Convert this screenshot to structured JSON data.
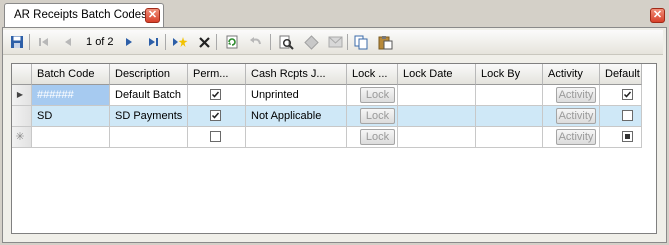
{
  "tab": {
    "title": "AR Receipts Batch Codes"
  },
  "toolbar": {
    "page_current": "1",
    "page_total": "of 2",
    "icons": [
      "save-icon",
      "first-record-icon",
      "previous-record-icon",
      "next-record-icon",
      "last-record-icon",
      "new-record-icon",
      "delete-icon",
      "refresh-icon",
      "undo-icon",
      "preview-icon",
      "diamond-icon",
      "mail-icon",
      "copy-icon",
      "paste-icon"
    ]
  },
  "grid": {
    "columns": [
      "Batch Code",
      "Description",
      "Perm...",
      "Cash Rcpts J...",
      "Lock ...",
      "Lock Date",
      "Lock By",
      "Activity",
      "Default"
    ],
    "rows": [
      {
        "batch_code": "######",
        "description": "Default Batch",
        "perm": true,
        "cash_rcpts": "Unprinted",
        "lock_label": "Lock",
        "lock_date": "",
        "lock_by": "",
        "activity_label": "Activity",
        "default": true
      },
      {
        "batch_code": "SD",
        "description": "SD Payments",
        "perm": true,
        "cash_rcpts": "Not Applicable",
        "lock_label": "Lock",
        "lock_date": "",
        "lock_by": "",
        "activity_label": "Activity",
        "default": false
      },
      {
        "batch_code": "",
        "description": "",
        "perm": false,
        "cash_rcpts": "",
        "lock_label": "Lock",
        "lock_date": "",
        "lock_by": "",
        "activity_label": "Activity",
        "default": null
      }
    ]
  },
  "colors": {
    "selected_row": "#cfe8f7",
    "selected_cell": "#a6caf0",
    "close_button": "#d8402a"
  }
}
